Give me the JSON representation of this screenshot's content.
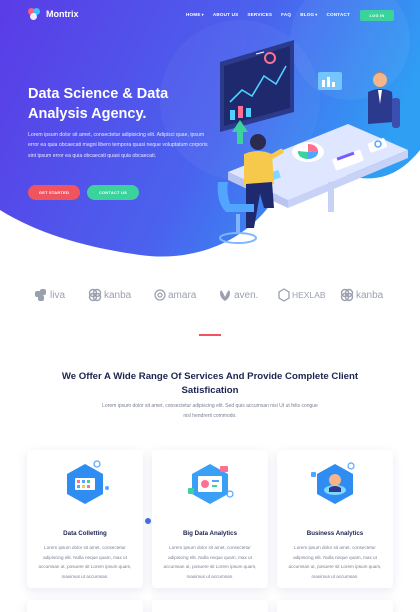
{
  "brand": {
    "name": "Montrix"
  },
  "nav": {
    "items": [
      {
        "label": "HOME",
        "dropdown": true
      },
      {
        "label": "ABOUT US",
        "dropdown": false
      },
      {
        "label": "SERVICES",
        "dropdown": false
      },
      {
        "label": "FAQ",
        "dropdown": false
      },
      {
        "label": "BLOG",
        "dropdown": true
      },
      {
        "label": "CONTACT",
        "dropdown": false
      }
    ],
    "login_label": "LOG IN"
  },
  "hero": {
    "title": "Data Science & Data Analysis Agency.",
    "text": "Lorem ipsum dolor sit amet, consectetur adipisicing elit. Adipisci quae, ipsum error ea quia obcaecati magni libero tempora quasi neque voluptatum corporis sint ipsum error ea quia obcaecati quasi quia obcaecati.",
    "btn_start": "GET STARTED",
    "btn_contact": "CONTACT US"
  },
  "clients": [
    "liva",
    "kanba",
    "amara",
    "aven.",
    "HEXLAB",
    "kanba"
  ],
  "section": {
    "title": "We Offer A Wide Range Of Services And Provide Complete Client Satisfication",
    "subtitle": "Lorem ipsum dolor sit amet, consectetur adipiscing elit. Sed quis accumsan nisi Ut ut felis congue nisl hendrerit commodo."
  },
  "cards": [
    {
      "title": "Data Colletting",
      "text": "Lorem ipsum dolor sit amet, consectetur adipiscing elit. Nulla neque quam, max ut accumsan ut, posuere sit Lorem ipsum quam, maximus ut accumsan."
    },
    {
      "title": "Big Data Analytics",
      "text": "Lorem ipsum dolor sit amet, consectetur adipiscing elit. Nulla neque quam, max ut accumsan ut, posuere sit Lorem ipsum quam, maximus ut accumsan."
    },
    {
      "title": "Business Analytics",
      "text": "Lorem ipsum dolor sit amet, consectetur adipiscing elit. Nulla neque quam, max ut accumsan ut, posuere sit Lorem ipsum quam, maximus ut accumsan."
    }
  ],
  "colors": {
    "hero_start": "#5b3be6",
    "hero_end": "#2f9ff4",
    "accent_red": "#f0545e",
    "accent_green": "#3bd39b"
  },
  "icons": [
    "logo-icon",
    "liva-icon",
    "kanba-icon",
    "amara-icon",
    "aven-icon",
    "hexlab-icon",
    "data-collecting-icon",
    "big-data-analytics-icon",
    "business-analytics-icon"
  ]
}
